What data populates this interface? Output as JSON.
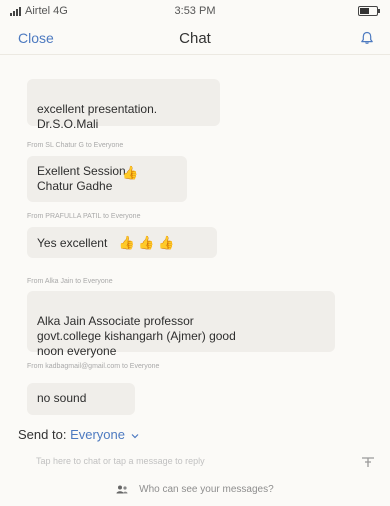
{
  "status": {
    "carrier": "Airtel 4G",
    "time": "3:53 PM"
  },
  "nav": {
    "close_label": "Close",
    "title": "Chat"
  },
  "messages": [
    {
      "sender": "",
      "text": "excellent presentation.\nDr.S.O.Mali",
      "emoji": ""
    },
    {
      "sender": "From SL Chatur G  to  Everyone",
      "text": "Exellent Session\nChatur Gadhe",
      "emoji": "👍"
    },
    {
      "sender": "From PRAFULLA PATIL  to  Everyone",
      "text": "Yes excellent",
      "emoji": "👍 👍 👍"
    },
    {
      "sender": "From Alka Jain  to  Everyone",
      "text": "Alka Jain Associate professor\ngovt.college kishangarh (Ajmer) good\nnoon everyone",
      "emoji": ""
    },
    {
      "sender": "From kadbagmail@gmail.com  to  Everyone",
      "text": "no sound",
      "emoji": ""
    }
  ],
  "composer": {
    "send_to_label": "Send to:",
    "send_to_target": "Everyone",
    "placeholder": "Tap here to chat or tap a message to reply",
    "who_can_see": "Who can see your messages?"
  },
  "colors": {
    "accent": "#4d7ac0",
    "bubble": "#f0eeea",
    "background": "#fbfaf7"
  },
  "icons": [
    "signal-icon",
    "battery-icon",
    "bell-icon",
    "send-icon",
    "people-icon",
    "chevron-down-icon"
  ]
}
